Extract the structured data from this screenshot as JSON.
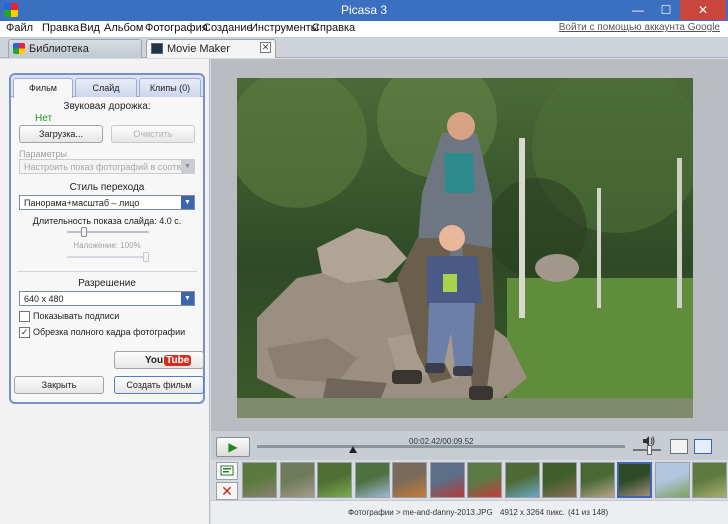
{
  "window": {
    "title": "Picasa 3",
    "min": "—",
    "max": "☐",
    "close": "✕"
  },
  "menu": {
    "items": [
      "Файл",
      "Правка",
      "Вид",
      "Альбом",
      "Фотография",
      "Создание",
      "Инструменты",
      "Справка"
    ],
    "signin": "Войти с помощью аккаунта Google"
  },
  "tabs": {
    "library": "Библиотека",
    "movie": "Movie Maker",
    "close": "✕"
  },
  "panel": {
    "tabs": [
      "Фильм",
      "Слайд",
      "Клипы (0)"
    ],
    "audio_label": "Звуковая дорожка:",
    "audio_value": "Нет",
    "load_button": "Загрузка...",
    "clear_button": "Очистить",
    "params_label": "Параметры",
    "params_value": "Настроить показ фотографий в соответствии с...",
    "transition_label": "Стиль перехода",
    "transition_value": "Панорама+масштаб – лицо",
    "duration_label": "Длительность показа слайда: 4.0 с.",
    "duration_fraction": 0.18,
    "overlap_label": "Наложение: 100%",
    "overlap_fraction": 1.0,
    "resolution_label": "Разрешение",
    "resolution_value": "640 x 480",
    "show_captions_label": "Показывать подписи",
    "show_captions_checked": false,
    "crop_label": "Обрезка полного кадра фотографии",
    "crop_checked": true,
    "check_mark": "✓"
  },
  "buttons": {
    "youtube_you": "You",
    "youtube_tube": "Tube",
    "close": "Закрыть",
    "create": "Создать фильм"
  },
  "player": {
    "play_icon": "▶",
    "timecode": "00:02.42/00:09.52",
    "position_fraction": 0.26,
    "volume_fraction": 0.6
  },
  "filmstrip": {
    "count": 13,
    "selected_index": 10,
    "remove_icon": "✕"
  },
  "status": {
    "path": "Фотографии > me-and-danny-2013.JPG",
    "dimensions": "4912 x 3264 пикс.",
    "counter": "(41 из 148)"
  },
  "colors": {
    "accent": "#3d64b1",
    "titlebar": "#3b6fbf",
    "close": "#c9463d"
  }
}
